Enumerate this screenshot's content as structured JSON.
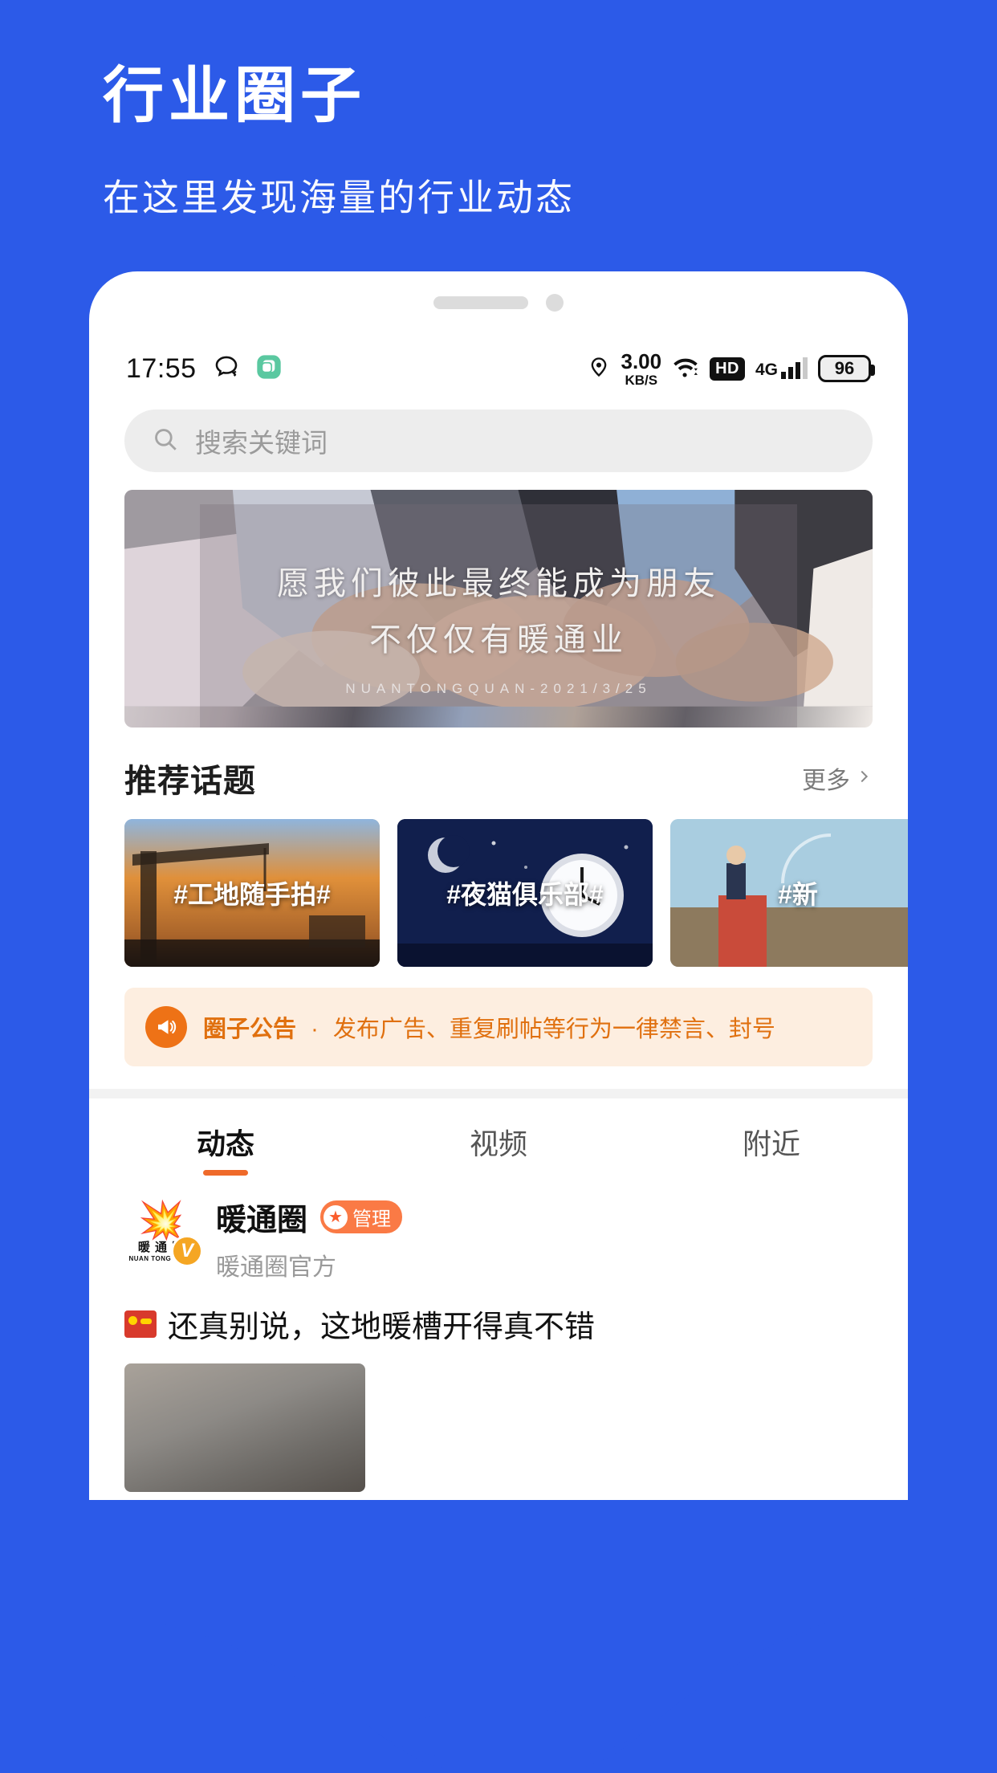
{
  "promo": {
    "title": "行业圈子",
    "subtitle": "在这里发现海量的行业动态",
    "background_color": "#2c5ae8"
  },
  "status_bar": {
    "time": "17:55",
    "chat_icon": "chat-bubble-icon",
    "app_icon": "green-app-icon",
    "location_icon": "location-pin-icon",
    "net_speed_value": "3.00",
    "net_speed_unit": "KB/S",
    "wifi_icon": "wifi-icon",
    "hd_label": "HD",
    "network_type": "4G",
    "battery_level": "96"
  },
  "search": {
    "placeholder": "搜索关键词",
    "icon": "search-icon"
  },
  "hero": {
    "line1": "愿我们彼此最终能成为朋友",
    "line2": "不仅仅有暖通业",
    "caption": "NUANTONGQUAN-2021/3/25"
  },
  "topics_section": {
    "title": "推荐话题",
    "more_label": "更多",
    "more_icon": "chevron-right-icon",
    "items": [
      {
        "label": "#工地随手拍#"
      },
      {
        "label": "#夜猫俱乐部#"
      },
      {
        "label": "#新"
      }
    ]
  },
  "announcement": {
    "icon": "megaphone-icon",
    "title": "圈子公告",
    "separator": "·",
    "text": "发布广告、重复刷帖等行为一律禁言、封号",
    "accent_color": "#e0700f",
    "background_color": "#fdeee0"
  },
  "tabs": [
    {
      "label": "动态",
      "active": true
    },
    {
      "label": "视频",
      "active": false
    },
    {
      "label": "附近",
      "active": false
    }
  ],
  "post": {
    "avatar_flame": "暖",
    "avatar_word": "暖 通 圈",
    "avatar_sub": "NUAN TONG QUAN",
    "verified_badge": "V",
    "author_name": "暖通圈",
    "admin_badge_label": "管理",
    "admin_badge_color": "#fa7a45",
    "subtitle": "暖通圈官方",
    "content": "还真别说，这地暖槽开得真不错"
  }
}
